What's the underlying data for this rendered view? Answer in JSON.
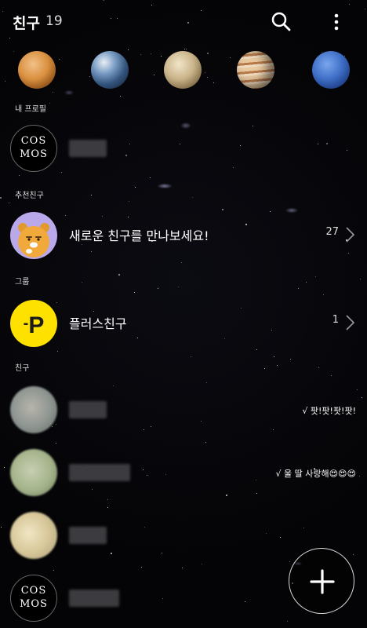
{
  "header": {
    "title": "친구",
    "count": "19"
  },
  "planets": [
    "venus",
    "earth",
    "mercury",
    "jupiter",
    "neptune"
  ],
  "sections": {
    "my_profile": "내 프로필",
    "recommended": "추천친구",
    "group": "그룹",
    "friends": "친구"
  },
  "my_profile": {
    "avatar_text": "COS MOS"
  },
  "recommended": {
    "label": "새로운 친구를 만나보세요!",
    "count": "27"
  },
  "group": {
    "label": "플러스친구",
    "count": "1",
    "badge": "P"
  },
  "friends": [
    {
      "status": "√ 팟!팟!팟!팟!"
    },
    {
      "status": "√ 울 딸 사랑해😍😍😍"
    },
    {
      "status": ""
    },
    {
      "status": "",
      "avatar_text": "COS MOS"
    }
  ],
  "colors": {
    "background": "#050507",
    "plus_badge": "#FFE100"
  }
}
